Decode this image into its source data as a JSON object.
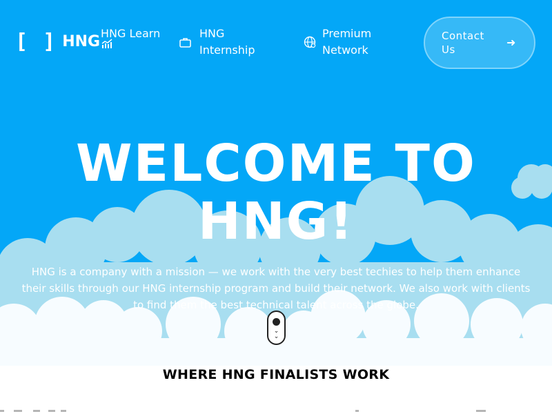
{
  "brand": {
    "logo_brackets": "[ ]",
    "logo_text": "HNG",
    "logo_icon": "growth-chart-icon"
  },
  "nav": {
    "learn": {
      "label": "HNG Learn"
    },
    "internship": {
      "label": "HNG Internship",
      "icon": "briefcase-icon"
    },
    "network": {
      "label": "Premium Network",
      "icon": "globe-icon"
    },
    "contact": {
      "label": "Contact Us",
      "icon": "arrow-right-icon"
    }
  },
  "hero": {
    "title": "WELCOME TO HNG!",
    "description": "HNG is a company with a mission — we work with the very best techies to help them enhance their skills through our HNG internship program and build their network. We also work with clients to find them the best technical talent across the globe."
  },
  "section": {
    "finalists_title": "WHERE HNG FINALISTS WORK"
  },
  "colors": {
    "hero_bg": "#04a7f7",
    "cloud_back": "#a8def0",
    "cloud_front": "#f7fcff",
    "text_white": "#ffffff"
  }
}
